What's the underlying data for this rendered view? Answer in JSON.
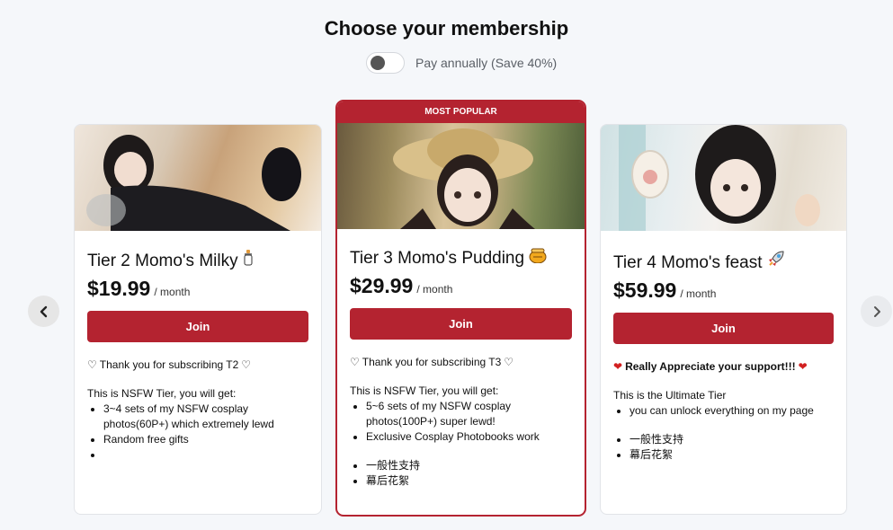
{
  "header": {
    "title": "Choose your membership",
    "billing_toggle_label": "Pay annually (Save 40%)"
  },
  "tiers": [
    {
      "name": "Tier 2 Momo's Milky",
      "name_icon": "baby-bottle-icon",
      "price": "$19.99",
      "period": "/ month",
      "join_label": "Join",
      "thanks": "Thank you for subscribing T2",
      "description": "This is NSFW Tier, you will get:",
      "bullets": [
        "3~4 sets of my NSFW cosplay photos(60P+) which extremely lewd",
        "Random free gifts",
        ""
      ]
    },
    {
      "badge": "MOST POPULAR",
      "name": "Tier 3 Momo's Pudding",
      "name_icon": "honey-pot-icon",
      "price": "$29.99",
      "period": "/ month",
      "join_label": "Join",
      "thanks": "Thank you for subscribing T3",
      "description": "This is NSFW Tier, you will get:",
      "bullets": [
        "5~6 sets of my NSFW cosplay photos(100P+) super lewd!",
        "Exclusive Cosplay Photobooks work"
      ],
      "extra_bullets": [
        "一般性支持",
        "幕后花絮"
      ]
    },
    {
      "name": "Tier 4 Momo's feast",
      "name_icon": "rocket-icon",
      "price": "$59.99",
      "period": "/ month",
      "join_label": "Join",
      "thanks": "Really Appreciate your support!!!",
      "description": "This is the Ultimate Tier",
      "bullets": [
        "you can unlock everything on my page"
      ],
      "extra_bullets": [
        "一般性支持",
        "幕后花絮"
      ]
    }
  ],
  "colors": {
    "accent": "#b42330",
    "background": "#f5f7fa"
  }
}
